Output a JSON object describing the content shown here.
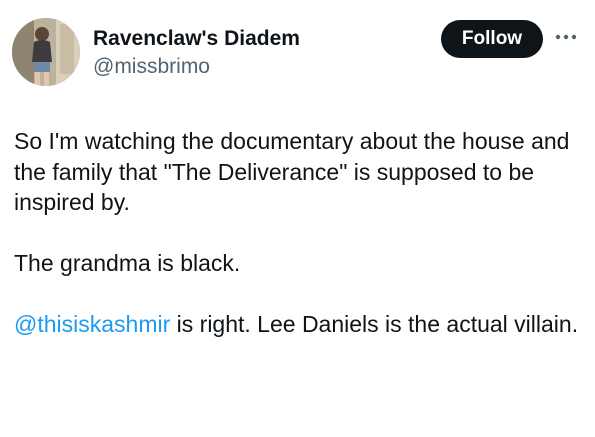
{
  "tweet": {
    "author": {
      "display_name": "Ravenclaw's Diadem",
      "handle": "@missbrimo",
      "avatar_icon": "avatar-photo"
    },
    "follow_label": "Follow",
    "more_icon": "more-dots-icon",
    "paragraphs": {
      "p1": "So I'm watching the documentary about the house and the family that \"The Deliverance\" is supposed to be inspired by.",
      "p2": "The grandma is black.",
      "p3": {
        "mention": "@thisiskashmir",
        "text": " is right.  Lee Daniels is the actual villain."
      }
    }
  },
  "colors": {
    "text": "#0f1419",
    "secondary": "#536471",
    "link": "#1d9bf0",
    "button_bg": "#0f1419",
    "button_text": "#ffffff"
  }
}
